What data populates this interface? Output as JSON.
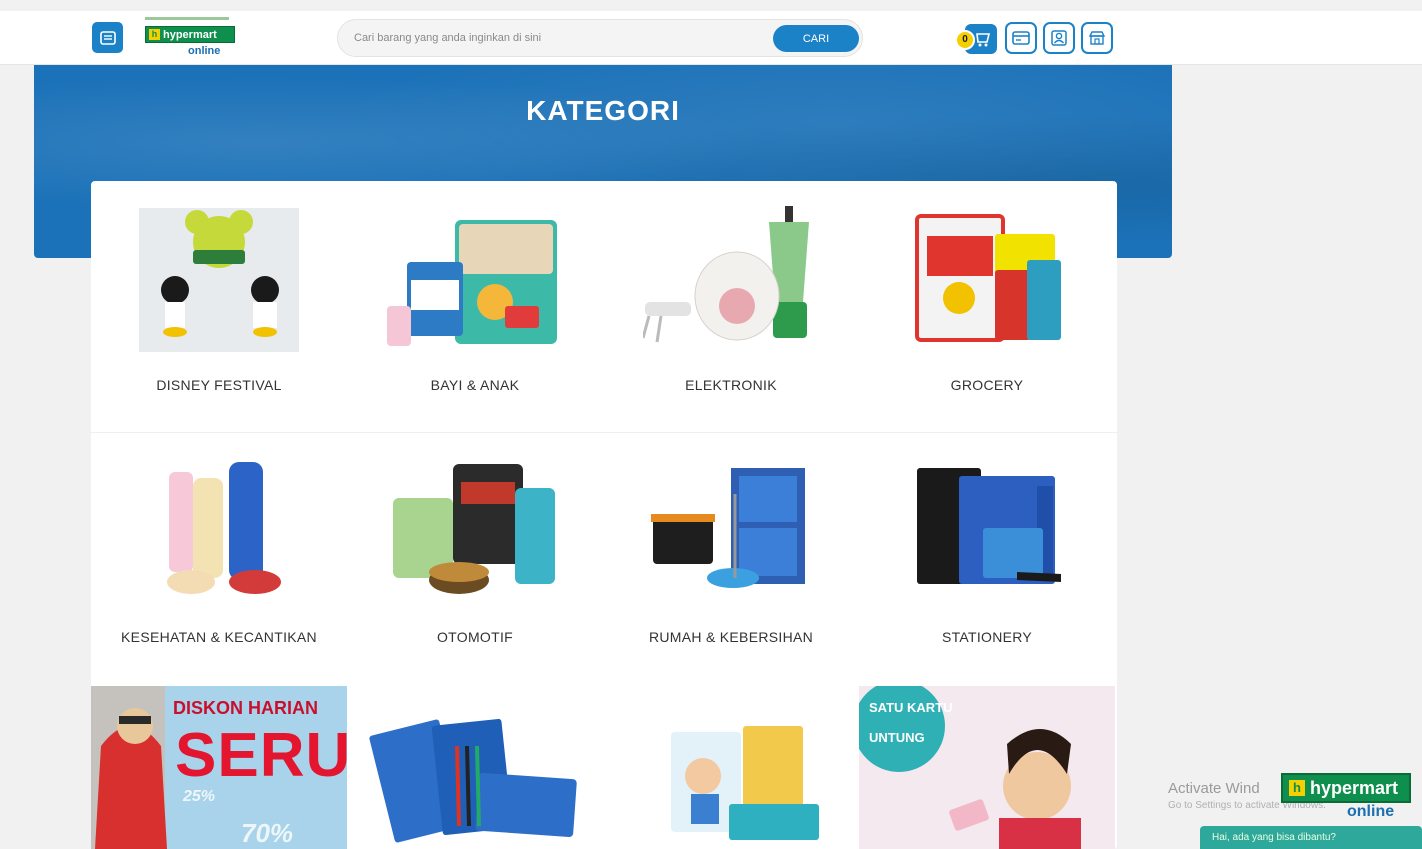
{
  "header": {
    "menu_icon": "menu-icon",
    "logo": {
      "brand": "hypermart",
      "sub": "online"
    },
    "search": {
      "placeholder": "Cari barang yang anda inginkan di sini",
      "button_label": "CARI"
    },
    "icons": [
      {
        "name": "cart-icon",
        "badge": "0"
      },
      {
        "name": "card-icon"
      },
      {
        "name": "account-icon"
      },
      {
        "name": "store-icon"
      }
    ]
  },
  "banner": {
    "title": "KATEGORI"
  },
  "categories": [
    {
      "label": "DISNEY FESTIVAL"
    },
    {
      "label": "BAYI & ANAK"
    },
    {
      "label": "ELEKTRONIK"
    },
    {
      "label": "GROCERY"
    },
    {
      "label": "KESEHATAN & KECANTIKAN"
    },
    {
      "label": "OTOMOTIF"
    },
    {
      "label": "RUMAH & KEBERSIHAN"
    },
    {
      "label": "STATIONERY"
    }
  ],
  "promos": [
    {
      "line1": "DISKON HARIAN",
      "line2": "SERU",
      "pct_a": "25%",
      "pct_b": "70%"
    },
    {
      "name": "stationery-promo"
    },
    {
      "name": "kids-promo"
    },
    {
      "line1": "SATU KARTU",
      "line2": "UNTUNG"
    }
  ],
  "overlay": {
    "activate_title": "Activate Wind",
    "activate_sub": "Go to Settings to activate Windows.",
    "chat_text": "Hai, ada yang bisa dibantu?"
  },
  "colors": {
    "primary": "#1c82c8",
    "banner": "#1c72b8",
    "brand_green": "#0f8f4d",
    "accent_yellow": "#f5d000",
    "promo_red": "#e3152f"
  }
}
